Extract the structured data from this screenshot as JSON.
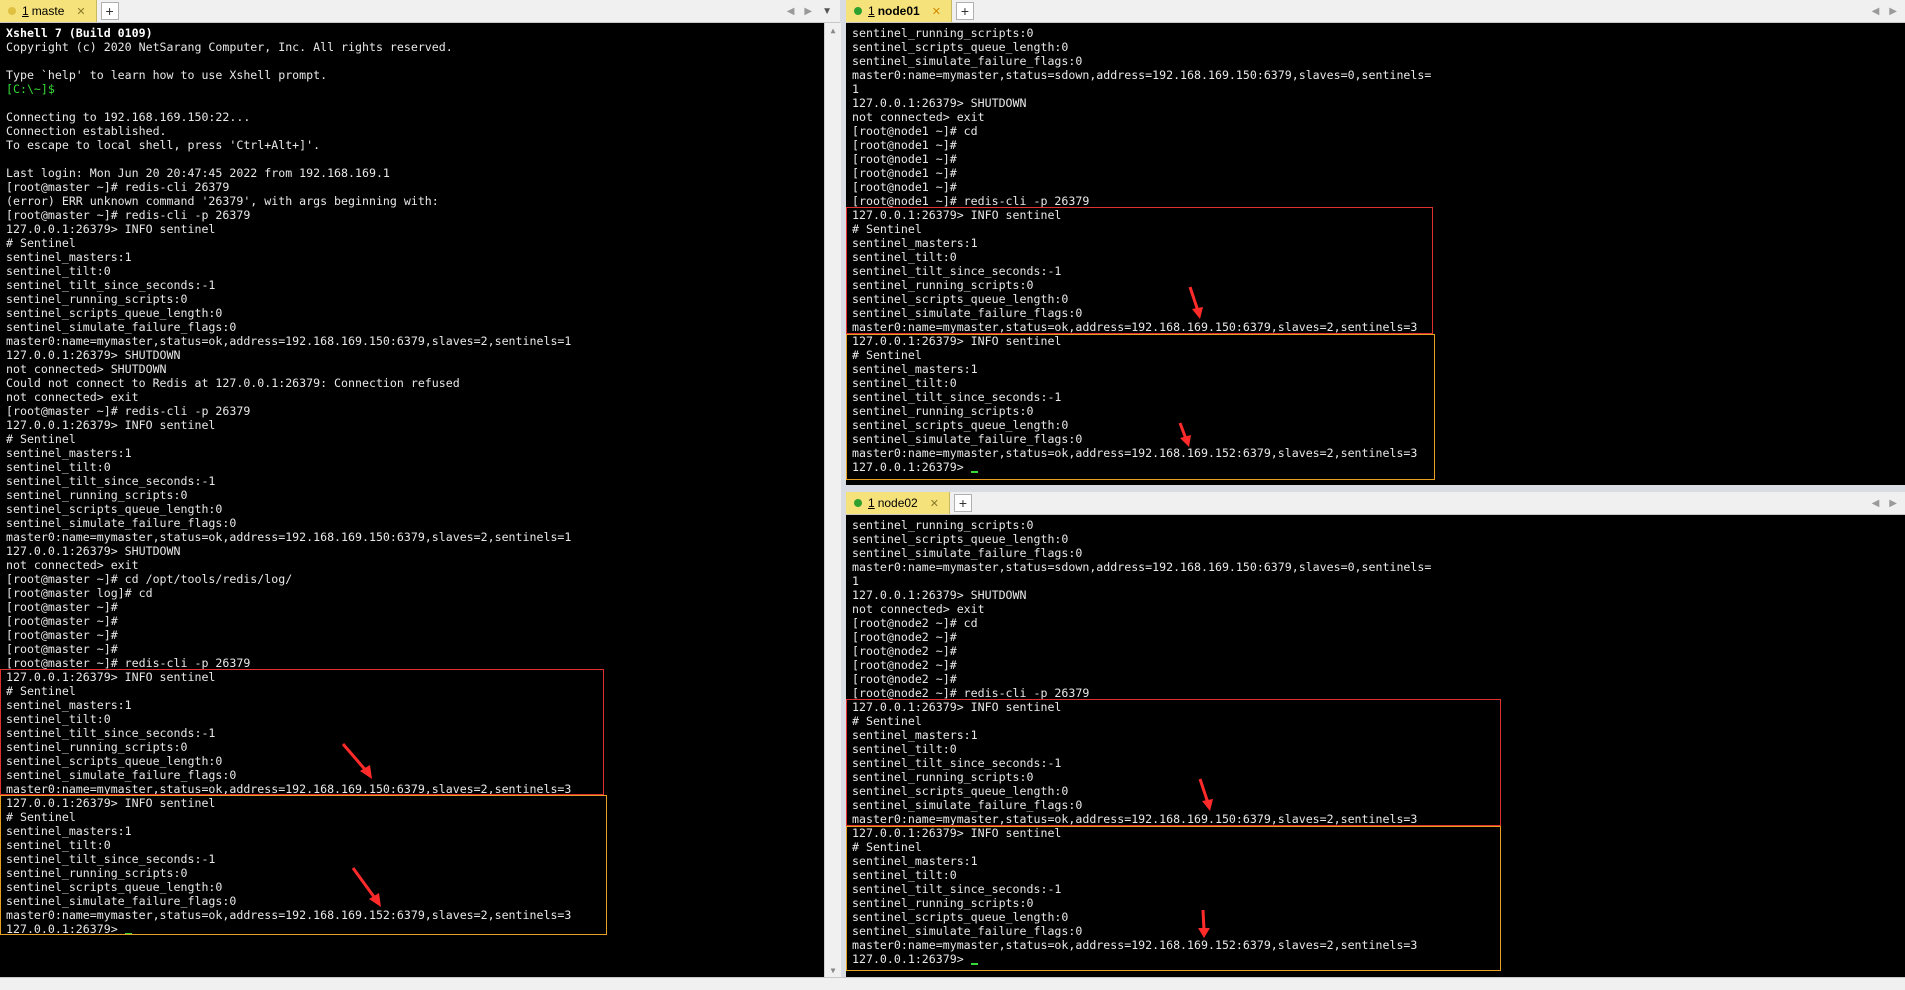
{
  "panes": {
    "master": {
      "tab": {
        "num": "1",
        "name": "maste",
        "dot_color": "#e0c040"
      },
      "lines": [
        "Xshell 7 (Build 0109)",
        "Copyright (c) 2020 NetSarang Computer, Inc. All rights reserved.",
        "",
        "Type `help' to learn how to use Xshell prompt.",
        "[C:\\~]$",
        "",
        "Connecting to 192.168.169.150:22...",
        "Connection established.",
        "To escape to local shell, press 'Ctrl+Alt+]'.",
        "",
        "Last login: Mon Jun 20 20:47:45 2022 from 192.168.169.1",
        "[root@master ~]# redis-cli 26379",
        "(error) ERR unknown command '26379', with args beginning with:",
        "[root@master ~]# redis-cli -p 26379",
        "127.0.0.1:26379> INFO sentinel",
        "# Sentinel",
        "sentinel_masters:1",
        "sentinel_tilt:0",
        "sentinel_tilt_since_seconds:-1",
        "sentinel_running_scripts:0",
        "sentinel_scripts_queue_length:0",
        "sentinel_simulate_failure_flags:0",
        "master0:name=mymaster,status=ok,address=192.168.169.150:6379,slaves=2,sentinels=1",
        "127.0.0.1:26379> SHUTDOWN",
        "not connected> SHUTDOWN",
        "Could not connect to Redis at 127.0.0.1:26379: Connection refused",
        "not connected> exit",
        "[root@master ~]# redis-cli -p 26379",
        "127.0.0.1:26379> INFO sentinel",
        "# Sentinel",
        "sentinel_masters:1",
        "sentinel_tilt:0",
        "sentinel_tilt_since_seconds:-1",
        "sentinel_running_scripts:0",
        "sentinel_scripts_queue_length:0",
        "sentinel_simulate_failure_flags:0",
        "master0:name=mymaster,status=ok,address=192.168.169.150:6379,slaves=2,sentinels=1",
        "127.0.0.1:26379> SHUTDOWN",
        "not connected> exit",
        "[root@master ~]# cd /opt/tools/redis/log/",
        "[root@master log]# cd",
        "[root@master ~]#",
        "[root@master ~]#",
        "[root@master ~]#",
        "[root@master ~]#",
        "[root@master ~]# redis-cli -p 26379",
        "127.0.0.1:26379> INFO sentinel",
        "# Sentinel",
        "sentinel_masters:1",
        "sentinel_tilt:0",
        "sentinel_tilt_since_seconds:-1",
        "sentinel_running_scripts:0",
        "sentinel_scripts_queue_length:0",
        "sentinel_simulate_failure_flags:0",
        "master0:name=mymaster,status=ok,address=192.168.169.150:6379,slaves=2,sentinels=3",
        "127.0.0.1:26379> INFO sentinel",
        "# Sentinel",
        "sentinel_masters:1",
        "sentinel_tilt:0",
        "sentinel_tilt_since_seconds:-1",
        "sentinel_running_scripts:0",
        "sentinel_scripts_queue_length:0",
        "sentinel_simulate_failure_flags:0",
        "master0:name=mymaster,status=ok,address=192.168.169.152:6379,slaves=2,sentinels=3",
        "127.0.0.1:26379> "
      ]
    },
    "node01": {
      "tab": {
        "num": "1",
        "name": "node01",
        "dot_color": "#2ea02e"
      },
      "lines": [
        "sentinel_running_scripts:0",
        "sentinel_scripts_queue_length:0",
        "sentinel_simulate_failure_flags:0",
        "master0:name=mymaster,status=sdown,address=192.168.169.150:6379,slaves=0,sentinels=",
        "1",
        "127.0.0.1:26379> SHUTDOWN",
        "not connected> exit",
        "[root@node1 ~]# cd",
        "[root@node1 ~]#",
        "[root@node1 ~]#",
        "[root@node1 ~]#",
        "[root@node1 ~]#",
        "[root@node1 ~]# redis-cli -p 26379",
        "127.0.0.1:26379> INFO sentinel",
        "# Sentinel",
        "sentinel_masters:1",
        "sentinel_tilt:0",
        "sentinel_tilt_since_seconds:-1",
        "sentinel_running_scripts:0",
        "sentinel_scripts_queue_length:0",
        "sentinel_simulate_failure_flags:0",
        "master0:name=mymaster,status=ok,address=192.168.169.150:6379,slaves=2,sentinels=3",
        "127.0.0.1:26379> INFO sentinel",
        "# Sentinel",
        "sentinel_masters:1",
        "sentinel_tilt:0",
        "sentinel_tilt_since_seconds:-1",
        "sentinel_running_scripts:0",
        "sentinel_scripts_queue_length:0",
        "sentinel_simulate_failure_flags:0",
        "master0:name=mymaster,status=ok,address=192.168.169.152:6379,slaves=2,sentinels=3",
        "127.0.0.1:26379> "
      ]
    },
    "node02": {
      "tab": {
        "num": "1",
        "name": "node02",
        "dot_color": "#2ea02e"
      },
      "lines": [
        "sentinel_running_scripts:0",
        "sentinel_scripts_queue_length:0",
        "sentinel_simulate_failure_flags:0",
        "master0:name=mymaster,status=sdown,address=192.168.169.150:6379,slaves=0,sentinels=",
        "1",
        "127.0.0.1:26379> SHUTDOWN",
        "not connected> exit",
        "[root@node2 ~]# cd",
        "[root@node2 ~]#",
        "[root@node2 ~]#",
        "[root@node2 ~]#",
        "[root@node2 ~]#",
        "[root@node2 ~]# redis-cli -p 26379",
        "127.0.0.1:26379> INFO sentinel",
        "# Sentinel",
        "sentinel_masters:1",
        "sentinel_tilt:0",
        "sentinel_tilt_since_seconds:-1",
        "sentinel_running_scripts:0",
        "sentinel_scripts_queue_length:0",
        "sentinel_simulate_failure_flags:0",
        "master0:name=mymaster,status=ok,address=192.168.169.150:6379,slaves=2,sentinels=3",
        "127.0.0.1:26379> INFO sentinel",
        "# Sentinel",
        "sentinel_masters:1",
        "sentinel_tilt:0",
        "sentinel_tilt_since_seconds:-1",
        "sentinel_running_scripts:0",
        "sentinel_scripts_queue_length:0",
        "sentinel_simulate_failure_flags:0",
        "master0:name=mymaster,status=ok,address=192.168.169.152:6379,slaves=2,sentinels=3",
        "127.0.0.1:26379> "
      ]
    }
  },
  "colors": {
    "terminal_bg": "#000000",
    "terminal_text": "#e8e8e8",
    "prompt_green": "#36d936",
    "highlight_red": "#e03030",
    "highlight_yellow": "#e8a020",
    "tab_yellow": "#f6e27a"
  },
  "icons": {
    "new_tab": "plus-icon",
    "tab_close": "close-icon",
    "scroll_left": "triangle-left-icon",
    "scroll_right": "triangle-right-icon",
    "tab_menu": "chevron-down-icon"
  }
}
